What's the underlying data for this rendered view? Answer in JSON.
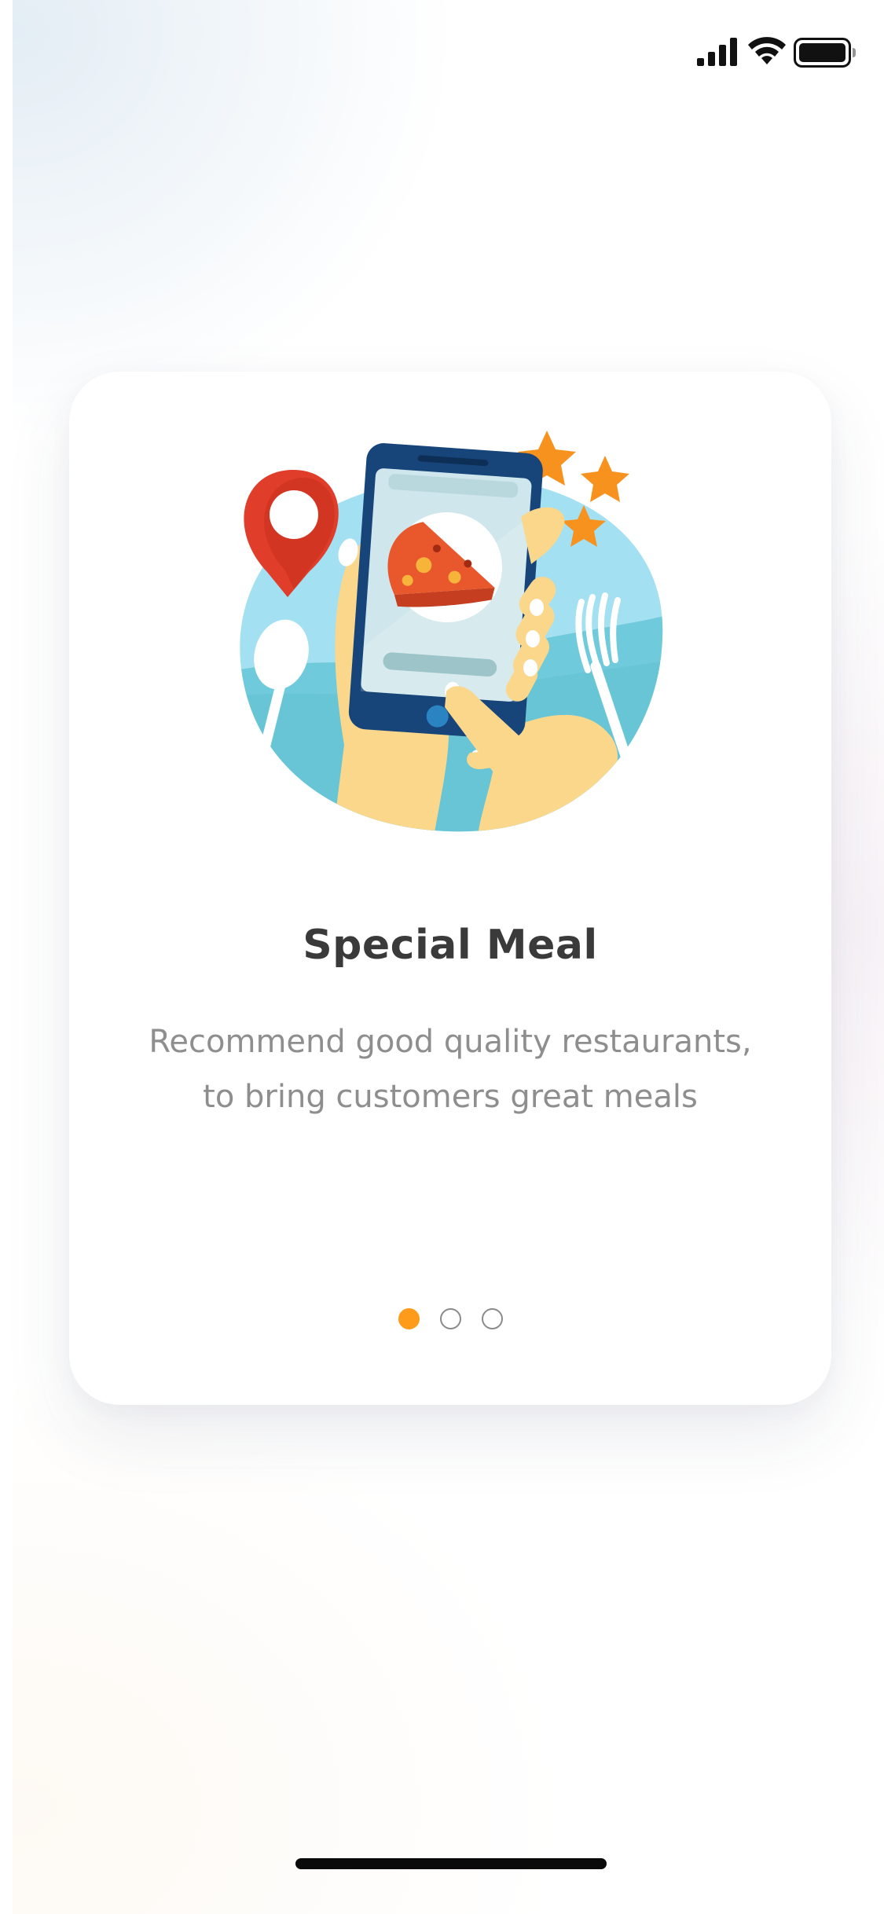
{
  "onboarding": {
    "title": "Special Meal",
    "description_lines": [
      "Recommend good quality restaurants,",
      "to bring customers great meals"
    ],
    "pager": {
      "total": 3,
      "active_index": 0
    },
    "illustration": "phone-ordering-pizza-illustration"
  },
  "status_bar": {
    "icons": [
      "signal-icon",
      "wifi-icon",
      "battery-icon"
    ]
  },
  "colors": {
    "accent": "#ff9b1a",
    "title": "#3a3a3a",
    "description": "#8e8e8e",
    "card_background": "#ffffff"
  }
}
